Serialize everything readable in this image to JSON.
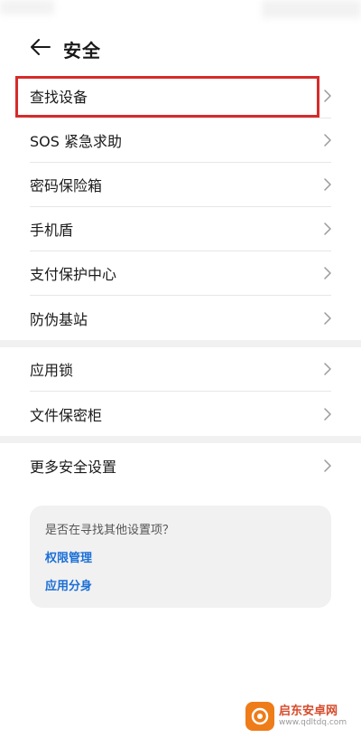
{
  "header": {
    "title": "安全"
  },
  "groups": [
    {
      "items": [
        {
          "label": "查找设备"
        },
        {
          "label": "SOS 紧急求助"
        },
        {
          "label": "密码保险箱"
        },
        {
          "label": "手机盾"
        },
        {
          "label": "支付保护中心"
        },
        {
          "label": "防伪基站"
        }
      ]
    },
    {
      "items": [
        {
          "label": "应用锁"
        },
        {
          "label": "文件保密柜"
        }
      ]
    },
    {
      "items": [
        {
          "label": "更多安全设置"
        }
      ]
    }
  ],
  "suggestions": {
    "question": "是否在寻找其他设置项？",
    "links": [
      "权限管理",
      "应用分身"
    ]
  },
  "highlight": {
    "target": "查找设备",
    "color": "#d62b2b"
  },
  "watermark": {
    "name": "启东安卓网",
    "url": "www.qdltdq.com"
  },
  "colors": {
    "link": "#1a6fd6",
    "divider": "#e6e6e6",
    "band": "#f1f1f1"
  }
}
